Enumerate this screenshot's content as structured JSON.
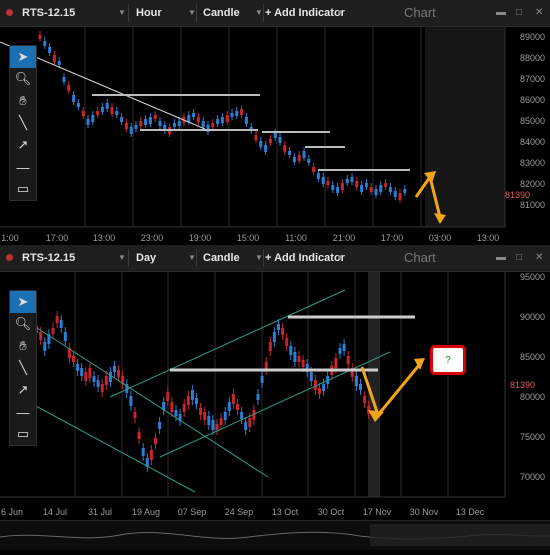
{
  "top": {
    "symbol": "RTS-12.15",
    "timeframe": "Hour",
    "chart_type": "Candle",
    "add_indicator": "+ Add Indicator",
    "title": "Chart",
    "price_label": "81390",
    "y_ticks": [
      "89000",
      "88000",
      "87000",
      "86000",
      "85000",
      "84000",
      "83000",
      "82000",
      "81000"
    ],
    "x_ticks": [
      "1:00",
      "17:00",
      "13:00",
      "23:00",
      "19:00",
      "15:00",
      "11:00",
      "21:00",
      "17:00",
      "03:00",
      "13:00"
    ]
  },
  "bottom": {
    "symbol": "RTS-12.15",
    "timeframe": "Day",
    "chart_type": "Candle",
    "add_indicator": "+ Add Indicator",
    "title": "Chart",
    "price_label": "81390",
    "question_mark": "?",
    "y_ticks": [
      "95000",
      "90000",
      "85000",
      "80000",
      "75000",
      "70000"
    ],
    "x_ticks": [
      "6 Jun",
      "14 Jul",
      "31 Jul",
      "19 Aug",
      "07 Sep",
      "24 Sep",
      "13 Oct",
      "30 Oct",
      "17 Nov",
      "30 Nov",
      "13 Dec"
    ]
  },
  "colors": {
    "bull": "#2a7fd6",
    "bear": "#c8262c",
    "arrow": "#f2a516",
    "accent": "#1b6fb3"
  },
  "tools": [
    "pointer-icon",
    "zoom-icon",
    "hand-icon",
    "line-icon",
    "arrow-icon",
    "hline-icon",
    "rect-icon"
  ]
}
